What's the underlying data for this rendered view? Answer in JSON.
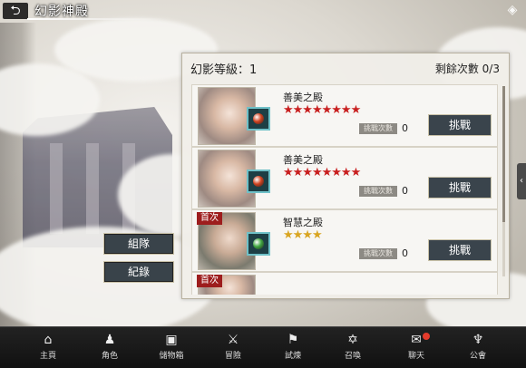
{
  "header": {
    "title": "幻影神殿",
    "back_icon": "⮌"
  },
  "left_buttons": {
    "party": "組隊",
    "records": "紀錄"
  },
  "panel": {
    "level_label": "幻影等級：1",
    "attempts_label": "剩餘次數 0/3"
  },
  "entries": [
    {
      "name": "善美之殿",
      "stars": "★★★★★★★★",
      "star_color": "red",
      "first": "",
      "badge": "挑戰次數",
      "count": "0",
      "action": "挑戰",
      "gem_color": "#d0421f"
    },
    {
      "name": "善美之殿",
      "stars": "★★★★★★★★",
      "star_color": "red",
      "first": "",
      "badge": "挑戰次數",
      "count": "0",
      "action": "挑戰",
      "gem_color": "#d0421f"
    },
    {
      "name": "智慧之殿",
      "stars": "★★★★",
      "star_color": "gold",
      "first": "首次",
      "badge": "挑戰次數",
      "count": "0",
      "action": "挑戰",
      "gem_color": "#3fa53f"
    }
  ],
  "partial_entry": {
    "first": "首次"
  },
  "nav": [
    {
      "label": "主頁",
      "icon": "⌂"
    },
    {
      "label": "角色",
      "icon": "♟"
    },
    {
      "label": "儲物箱",
      "icon": "▣"
    },
    {
      "label": "冒險",
      "icon": "⚔"
    },
    {
      "label": "試煉",
      "icon": "⚑"
    },
    {
      "label": "召喚",
      "icon": "✡"
    },
    {
      "label": "聊天",
      "icon": "✉"
    },
    {
      "label": "公會",
      "icon": "♆"
    }
  ],
  "colors": {
    "accent": "#3a444c",
    "star_red": "#c81f1f",
    "star_gold": "#d9a521",
    "notify": "#e53b2c"
  }
}
